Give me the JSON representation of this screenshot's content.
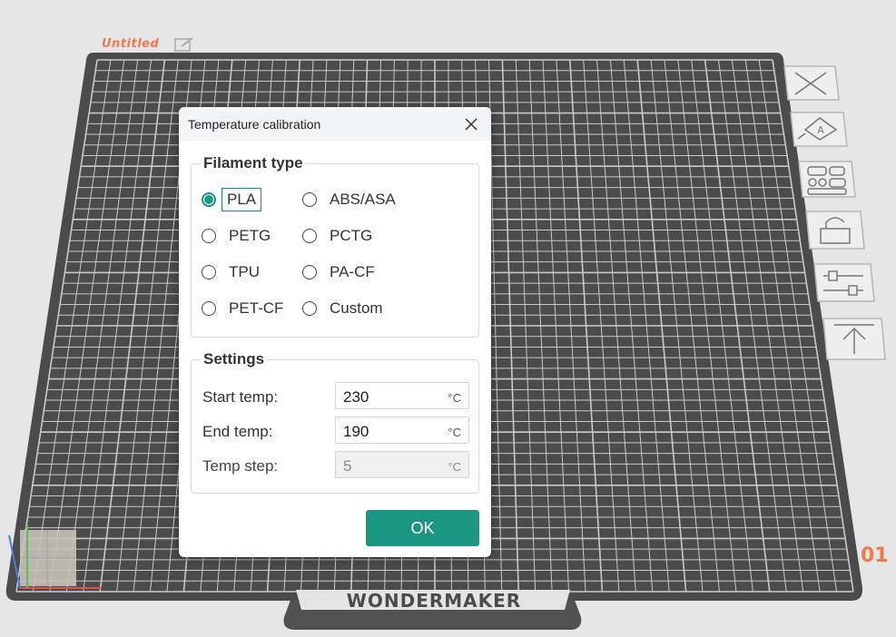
{
  "project": {
    "title": "Untitled"
  },
  "plate": {
    "brand": "WONDERMAKER",
    "index": "01"
  },
  "dialog": {
    "title": "Temperature calibration",
    "filament_group_title": "Filament type",
    "filaments": [
      {
        "label": "PLA",
        "selected": true
      },
      {
        "label": "ABS/ASA",
        "selected": false
      },
      {
        "label": "PETG",
        "selected": false
      },
      {
        "label": "PCTG",
        "selected": false
      },
      {
        "label": "TPU",
        "selected": false
      },
      {
        "label": "PA-CF",
        "selected": false
      },
      {
        "label": "PET-CF",
        "selected": false
      },
      {
        "label": "Custom",
        "selected": false
      }
    ],
    "settings_group_title": "Settings",
    "settings": {
      "start_temp": {
        "label": "Start temp:",
        "value": "230",
        "unit": "°C"
      },
      "end_temp": {
        "label": "End temp:",
        "value": "190",
        "unit": "°C"
      },
      "temp_step": {
        "label": "Temp step:",
        "value": "5",
        "unit": "°C"
      }
    },
    "ok_label": "OK"
  },
  "colors": {
    "accent": "#1a9683",
    "project_title": "#f07a4a",
    "plate": "#4a4b4a",
    "grid": "#c7c7c7"
  },
  "toolbar_icons": [
    "delete-icon",
    "auto-orient-icon",
    "arrange-icon",
    "lock-icon",
    "adjust-icon",
    "place-on-face-icon"
  ]
}
